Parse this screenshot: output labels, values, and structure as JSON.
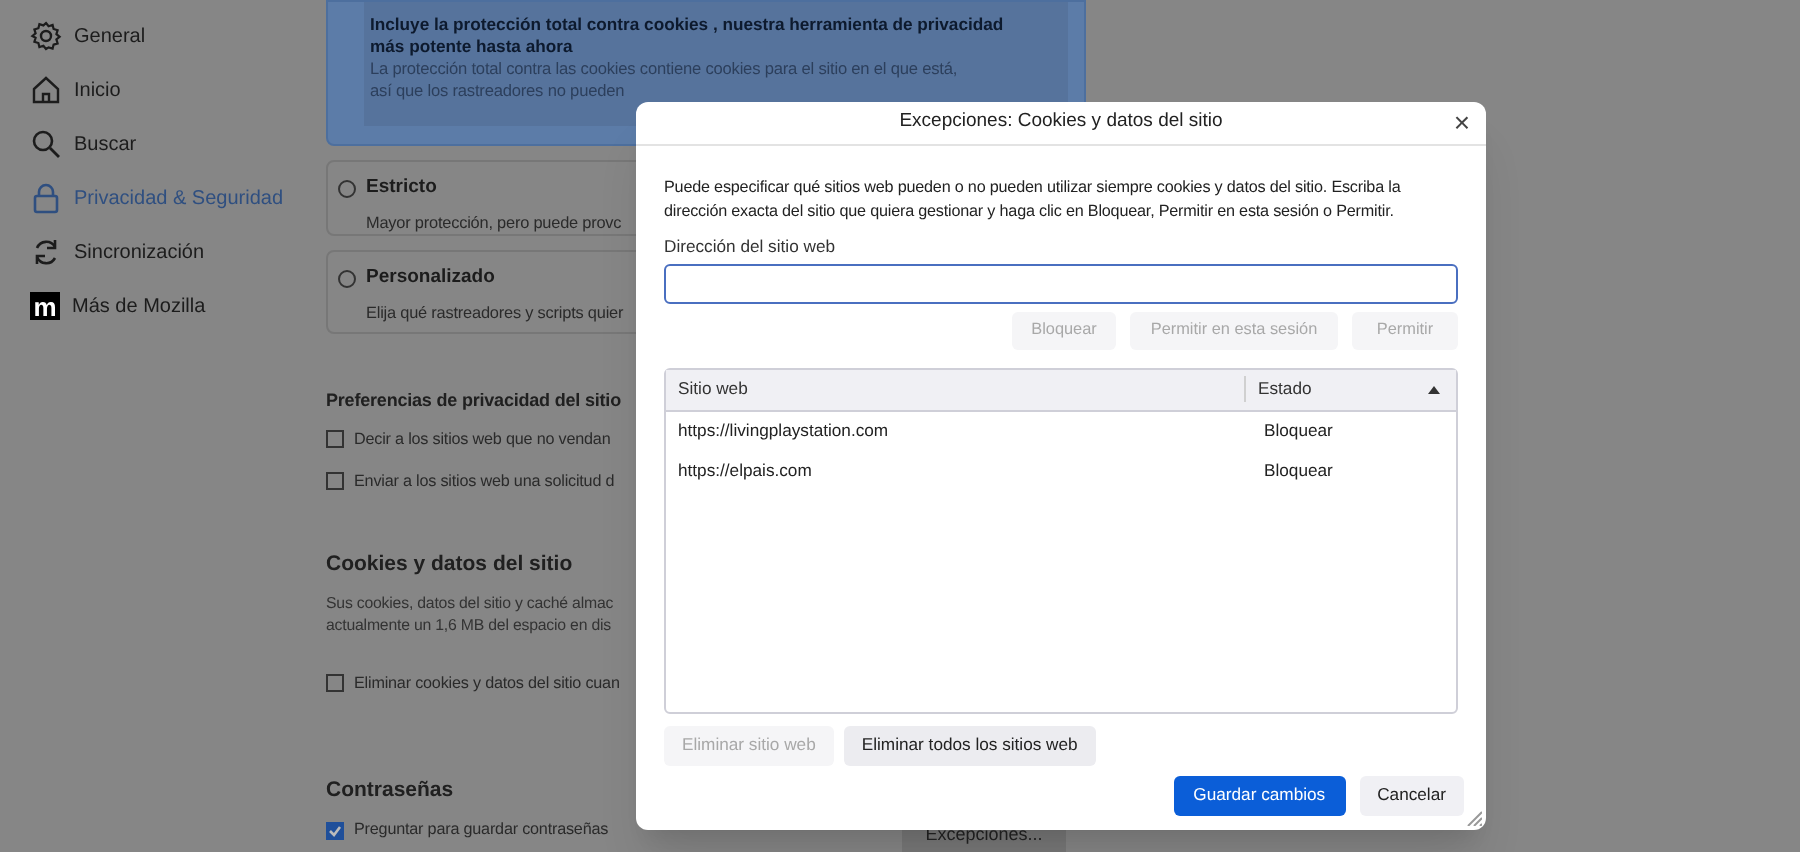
{
  "sidebar": {
    "items": [
      {
        "label": "General",
        "selected": false
      },
      {
        "label": "Inicio",
        "selected": false
      },
      {
        "label": "Buscar",
        "selected": false
      },
      {
        "label": "Privacidad & Seguridad",
        "selected": true
      },
      {
        "label": "Sincronización",
        "selected": false
      },
      {
        "label": "Más de Mozilla",
        "logo_text": "m",
        "selected": false
      }
    ]
  },
  "content": {
    "banner": {
      "title": "Incluye la protección total contra cookies , nuestra herramienta de privacidad más potente hasta ahora",
      "lines": [
        "La protección total contra las cookies contiene cookies para el sitio en el que está,",
        "así que los rastreadores no pueden"
      ]
    },
    "options": [
      {
        "title": "Estricto",
        "description": "Mayor protección, pero puede provc",
        "selected": false
      },
      {
        "title": "Personalizado",
        "description": "Elija qué rastreadores y scripts quier",
        "selected": false
      }
    ],
    "privacy_heading": "Preferencias de privacidad del sitio",
    "privacy_checks": [
      {
        "label": "Decir a los sitios web que no vendan",
        "checked": false
      },
      {
        "label": "Enviar a los sitios web una solicitud d",
        "checked": false
      }
    ],
    "cookies_heading": "Cookies y datos del sitio",
    "cookies_text": [
      "Sus cookies, datos del sitio y caché almac",
      "actualmente un 1,6 MB del espacio en dis"
    ],
    "cookies_check": {
      "label": "Eliminar cookies y datos del sitio cuan",
      "checked": false
    },
    "passwords_heading": "Contraseñas",
    "passwords_check": {
      "label": "Preguntar para guardar contraseñas",
      "checked": true
    },
    "exceptions_button": "Excepciones..."
  },
  "dialog": {
    "title": "Excepciones: Cookies y datos del sitio",
    "close": "×",
    "description": "Puede especificar qué sitios web pueden o no pueden utilizar siempre cookies y datos del sitio. Escriba la dirección exacta del sitio que quiera gestionar y haga clic en Bloquear, Permitir en esta sesión o Permitir.",
    "address_label": "Dirección del sitio web",
    "actions": [
      {
        "label": "Bloquear",
        "disabled": true
      },
      {
        "label": "Permitir en esta sesión",
        "disabled": true
      },
      {
        "label": "Permitir",
        "disabled": true
      }
    ],
    "table": {
      "columns": [
        {
          "label": "Sitio web",
          "sorted": false
        },
        {
          "label": "Estado",
          "sorted": true
        }
      ],
      "rows": [
        [
          "https://livingplaystation.com",
          "Bloquear"
        ],
        [
          "https://elpais.com",
          "Bloquear"
        ]
      ]
    },
    "remove_buttons": [
      {
        "label": "Eliminar sitio web",
        "disabled": true
      },
      {
        "label": "Eliminar todos los sitios web",
        "disabled": false
      }
    ],
    "footer_buttons": [
      {
        "label": "Guardar cambios",
        "kind": "primary"
      },
      {
        "label": "Cancelar",
        "kind": "secondary"
      }
    ]
  }
}
